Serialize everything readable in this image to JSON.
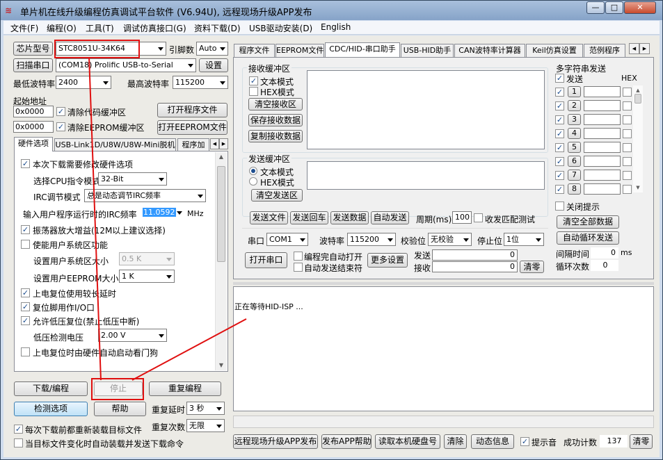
{
  "window": {
    "title": "单片机在线升级编程仿真调试平台软件 (V6.94U), 远程现场升级APP发布",
    "minimize": "—",
    "maximize": "□",
    "close": "✕"
  },
  "menu": [
    "文件(F)",
    "编程(O)",
    "工具(T)",
    "调试仿真接口(G)",
    "资料下载(D)",
    "USB驱动安装(D)",
    "English"
  ],
  "left": {
    "chip_btn": "芯片型号",
    "chip_value": "STC8051U-34K64",
    "pins_label": "引脚数",
    "pins_value": "Auto",
    "scan_btn": "扫描串口",
    "port_value": "(COM18) Prolific USB-to-Serial",
    "settings_btn": "设置",
    "min_baud_label": "最低波特率",
    "min_baud_value": "2400",
    "max_baud_label": "最高波特率",
    "max_baud_value": "115200",
    "start_addr_label": "起始地址",
    "addr1": "0x0000",
    "clear_code": "清除代码缓冲区",
    "open_prog": "打开程序文件",
    "addr2": "0x0000",
    "clear_eeprom": "清除EEPROM缓冲区",
    "open_eeprom": "打开EEPROM文件",
    "tabs": [
      "硬件选项",
      "USB-Link1D/U8W/U8W-Mini脱机",
      "程序加"
    ],
    "hw": {
      "need_modify": "本次下载需要修改硬件选项",
      "cpu_mode_label": "选择CPU指令模式",
      "cpu_mode_value": "32-Bit",
      "irc_mode_label": "IRC调节模式",
      "irc_mode_value": "总是动态调节IRC频率",
      "freq_label": "输入用户程序运行时的IRC频率",
      "freq_value": "11.0592",
      "freq_unit": "MHz",
      "osc_gain": "振荡器放大增益(12M以上建议选择)",
      "user_sys_area": "使能用户系统区功能",
      "sys_area_size_label": "设置用户系统区大小",
      "sys_area_size_value": "0.5 K",
      "eeprom_size_label": "设置用户EEPROM大小",
      "eeprom_size_value": "1   K",
      "por_delay": "上电复位使用较长延时",
      "reset_io": "复位脚用作I/O口",
      "lvd_reset": "允许低压复位(禁止低压中断)",
      "lvd_voltage_label": "低压检测电压",
      "lvd_voltage_value": "2.00 V",
      "wdt_start": "上电复位时由硬件自动启动看门狗"
    },
    "download_btn": "下载/编程",
    "stop_btn": "停止",
    "reprogram_btn": "重复编程",
    "detect_btn": "检测选项",
    "help_btn": "帮助",
    "repeat_delay_label": "重复延时",
    "repeat_delay_value": "3 秒",
    "repeat_count_label": "重复次数",
    "repeat_count_value": "无限",
    "reload_before": "每次下载前都重新装载目标文件",
    "auto_load": "当目标文件变化时自动装载并发送下载命令"
  },
  "right": {
    "tabs": [
      "程序文件",
      "EEPROM文件",
      "CDC/HID-串口助手",
      "USB-HID助手",
      "CAN波特率计算器",
      "Keil仿真设置",
      "范例程序"
    ],
    "recv_title": "接收缓冲区",
    "recv_text_mode": "文本模式",
    "recv_hex_mode": "HEX模式",
    "clear_recv": "清空接收区",
    "save_recv": "保存接收数据",
    "copy_recv": "复制接收数据",
    "send_title": "发送缓冲区",
    "send_text_mode": "文本模式",
    "send_hex_mode": "HEX模式",
    "clear_send": "清空发送区",
    "send_file": "发送文件",
    "send_return": "发送回车",
    "send_data": "发送数据",
    "auto_send": "自动发送",
    "period_label": "周期(ms)",
    "period_value": "100",
    "recv_match": "收发匹配测试",
    "port_label": "串口",
    "port_value": "COM1",
    "baud_label": "波特率",
    "baud_value": "115200",
    "parity_label": "校验位",
    "parity_value": "无校验",
    "stop_label": "停止位",
    "stop_value": "1位",
    "open_port": "打开串口",
    "auto_open": "编程完自动打开",
    "auto_close": "自动发送结束符",
    "more_settings": "更多设置",
    "send_count_label": "发送",
    "send_count": "0",
    "recv_count_label": "接收",
    "recv_count": "0",
    "clear_count": "清零",
    "multi": {
      "title": "多字符串发送",
      "send_col": "发送",
      "hex_col": "HEX",
      "rows": [
        "1",
        "2",
        "3",
        "4",
        "5",
        "6",
        "7",
        "8"
      ],
      "close_hint": "关闭提示",
      "clear_all": "清空全部数据",
      "auto_loop": "自动循环发送",
      "interval_label": "间隔时间",
      "interval_value": "0",
      "interval_unit": "ms",
      "loop_label": "循环次数",
      "loop_value": "0"
    },
    "log_text": "正在等待HID-ISP ...",
    "bottom": {
      "remote_upgrade": "远程现场升级APP发布",
      "publish_help": "发布APP帮助",
      "read_disk": "读取本机硬盘号",
      "clear": "清除",
      "anim": "动态信息",
      "sound": "提示音",
      "success_label": "成功计数",
      "success_value": "137",
      "reset": "清零"
    }
  },
  "annotation_color": "#e01010"
}
